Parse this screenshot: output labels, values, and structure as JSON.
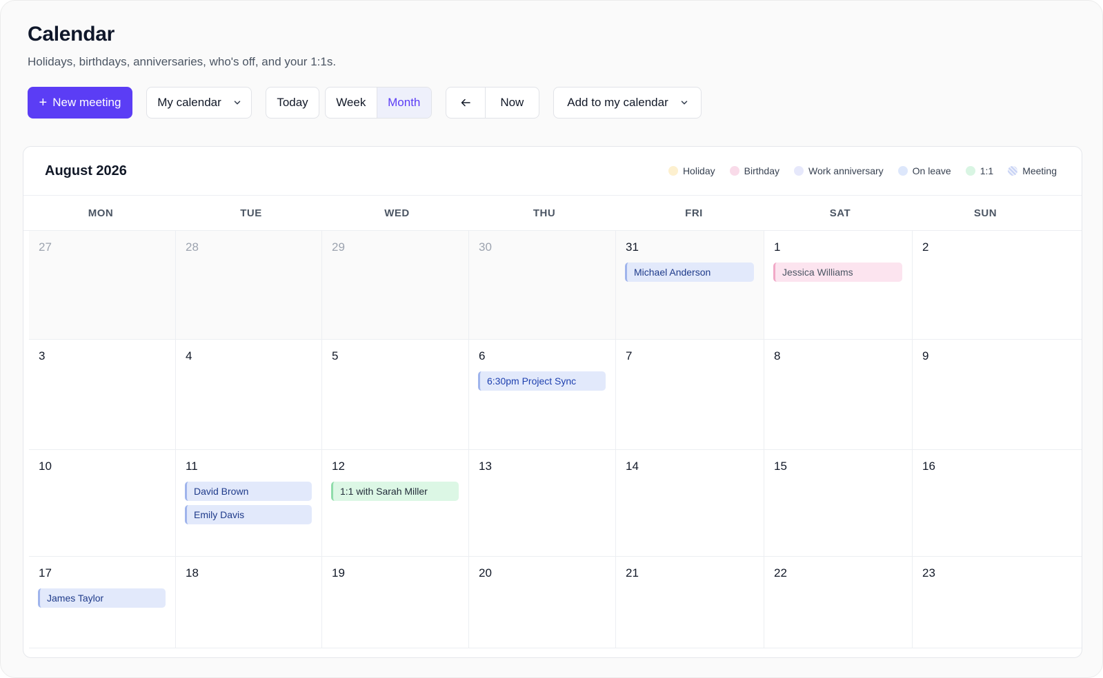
{
  "header": {
    "title": "Calendar",
    "subtitle": "Holidays, birthdays, anniversaries, who's off, and your 1:1s."
  },
  "toolbar": {
    "new_meeting": "New meeting",
    "calendar_select": "My calendar",
    "today": "Today",
    "view_week": "Week",
    "view_month": "Month",
    "active_view": "Month",
    "prev_icon": "arrow-left-icon",
    "now": "Now",
    "add_to_calendar": "Add to my calendar"
  },
  "calendar": {
    "month_label": "August 2026",
    "legend": [
      {
        "label": "Holiday",
        "color": "#fdf0cf"
      },
      {
        "label": "Birthday",
        "color": "#f9dbe9"
      },
      {
        "label": "Work anniversary",
        "color": "#e6e8fb"
      },
      {
        "label": "On leave",
        "color": "#dde7fb"
      },
      {
        "label": "1:1",
        "color": "#d9f5e3"
      },
      {
        "label": "Meeting",
        "color": "#c7d2f5"
      }
    ],
    "weekdays": [
      "MON",
      "TUE",
      "WED",
      "THU",
      "FRI",
      "SAT",
      "SUN"
    ],
    "weeks": [
      [
        {
          "day": "27",
          "outside": true,
          "events": []
        },
        {
          "day": "28",
          "outside": true,
          "events": []
        },
        {
          "day": "29",
          "outside": true,
          "events": []
        },
        {
          "day": "30",
          "outside": true,
          "events": []
        },
        {
          "day": "31",
          "outside": true,
          "events": [
            {
              "label": "Michael Anderson",
              "type": "leave"
            }
          ]
        },
        {
          "day": "1",
          "outside": false,
          "events": [
            {
              "label": "Jessica Williams",
              "type": "birthday"
            }
          ]
        },
        {
          "day": "2",
          "outside": false,
          "events": []
        }
      ],
      [
        {
          "day": "3",
          "outside": false,
          "events": []
        },
        {
          "day": "4",
          "outside": false,
          "events": []
        },
        {
          "day": "5",
          "outside": false,
          "events": []
        },
        {
          "day": "6",
          "outside": false,
          "events": [
            {
              "label": "6:30pm Project Sync",
              "type": "meeting"
            }
          ]
        },
        {
          "day": "7",
          "outside": false,
          "events": []
        },
        {
          "day": "8",
          "outside": false,
          "events": []
        },
        {
          "day": "9",
          "outside": false,
          "events": []
        }
      ],
      [
        {
          "day": "10",
          "outside": false,
          "events": []
        },
        {
          "day": "11",
          "outside": false,
          "events": [
            {
              "label": "David Brown",
              "type": "leave"
            },
            {
              "label": "Emily Davis",
              "type": "leave"
            }
          ]
        },
        {
          "day": "12",
          "outside": false,
          "events": [
            {
              "label": "1:1 with Sarah Miller",
              "type": "one-on-one"
            }
          ]
        },
        {
          "day": "13",
          "outside": false,
          "events": []
        },
        {
          "day": "14",
          "outside": false,
          "events": []
        },
        {
          "day": "15",
          "outside": false,
          "events": []
        },
        {
          "day": "16",
          "outside": false,
          "events": []
        }
      ],
      [
        {
          "day": "17",
          "outside": false,
          "events": [
            {
              "label": "James Taylor",
              "type": "leave"
            }
          ]
        },
        {
          "day": "18",
          "outside": false,
          "events": []
        },
        {
          "day": "19",
          "outside": false,
          "events": []
        },
        {
          "day": "20",
          "outside": false,
          "events": []
        },
        {
          "day": "21",
          "outside": false,
          "events": []
        },
        {
          "day": "22",
          "outside": false,
          "events": []
        },
        {
          "day": "23",
          "outside": false,
          "events": []
        }
      ]
    ]
  }
}
